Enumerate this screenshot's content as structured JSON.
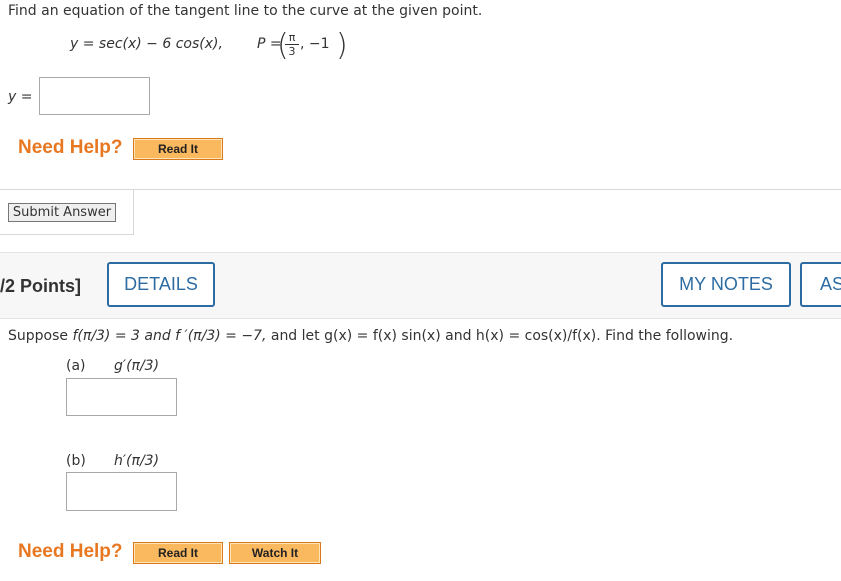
{
  "q1": {
    "prompt": "Find an equation of the tangent line to the curve at the given point.",
    "equation": "y = sec(x) − 6 cos(x),",
    "point_label": "P =",
    "point_num": "π",
    "point_den": "3",
    "point_rest": ", −1",
    "answer_label": "y =",
    "answer_value": "",
    "need_help": "Need Help?",
    "read_it": "Read It",
    "submit": "Submit Answer"
  },
  "q2": {
    "points": "/2 Points]",
    "details": "DETAILS",
    "my_notes": "MY NOTES",
    "ask_partial": "AS",
    "statement_intro": "Suppose",
    "statement_f": "f(π/3) = 3 and f ′(π/3) = −7,",
    "statement_g": "and let g(x) = f(x) sin(x) and h(x) = cos(x)/f(x). Find the following.",
    "part_a_label": "(a)",
    "part_a_expr": "g′(π/3)",
    "part_a_value": "",
    "part_b_label": "(b)",
    "part_b_expr": "h′(π/3)",
    "part_b_value": "",
    "need_help": "Need Help?",
    "read_it": "Read It",
    "watch_it": "Watch It"
  }
}
